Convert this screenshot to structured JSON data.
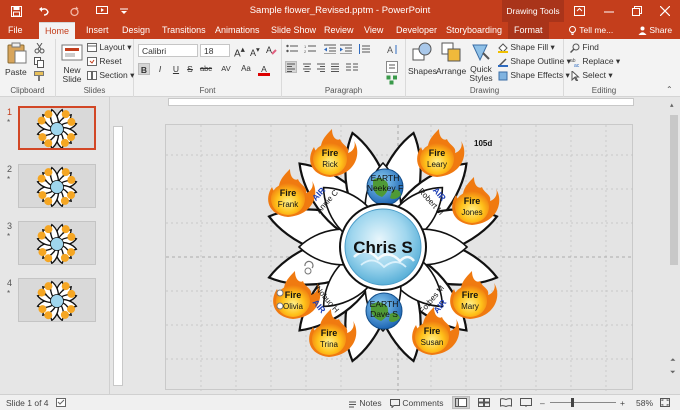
{
  "titlebar": {
    "document_title": "Sample flower_Revised.pptm - PowerPoint",
    "context_tools": "Drawing Tools",
    "icons": [
      "save-icon",
      "undo-icon",
      "redo-icon",
      "start-from-beginning-icon",
      "customize-qat-icon"
    ]
  },
  "tabs": [
    "File",
    "Home",
    "Insert",
    "Design",
    "Transitions",
    "Animations",
    "Slide Show",
    "Review",
    "View",
    "Developer",
    "Storyboarding",
    "Format"
  ],
  "active_tab": "Home",
  "tell_me": "Tell me...",
  "share": "Share",
  "ribbon": {
    "clipboard": {
      "paste": "Paste",
      "label": "Clipboard"
    },
    "slides": {
      "new_slide": "New Slide",
      "layout": "Layout",
      "reset": "Reset",
      "section": "Section",
      "label": "Slides"
    },
    "font": {
      "font_name": "Calibri",
      "font_size": "18",
      "label": "Font",
      "buttons": [
        "B",
        "I",
        "U",
        "S",
        "abc",
        "AV",
        "Aa",
        "A"
      ]
    },
    "paragraph": {
      "label": "Paragraph"
    },
    "drawing": {
      "shapes": "Shapes",
      "arrange": "Arrange",
      "quick_styles": "Quick Styles",
      "shape_fill": "Shape Fill",
      "shape_outline": "Shape Outline",
      "shape_effects": "Shape Effects",
      "label": "Drawing"
    },
    "editing": {
      "find": "Find",
      "replace": "Replace",
      "select": "Select",
      "label": "Editing"
    }
  },
  "thumbnails": [
    {
      "number": "1",
      "marker": "*",
      "selected": true
    },
    {
      "number": "2",
      "marker": "*",
      "selected": false
    },
    {
      "number": "3",
      "marker": "*",
      "selected": false
    },
    {
      "number": "4",
      "marker": "*",
      "selected": false
    }
  ],
  "slide": {
    "corner_label": "105d",
    "center_name": "Chris S",
    "earth": [
      {
        "label": "EARTH",
        "name": "Neekey F"
      },
      {
        "label": "EARTH",
        "name": "Dave S"
      }
    ],
    "air": [
      {
        "label": "AIR",
        "name": "Annie C"
      },
      {
        "label": "AIR",
        "name": "Robert M"
      },
      {
        "label": "AIR",
        "name": "Nobuo H"
      },
      {
        "label": "AIR",
        "name": "Forbes M"
      }
    ],
    "fire": [
      {
        "label": "Fire",
        "name": "Rick"
      },
      {
        "label": "Fire",
        "name": "Leary"
      },
      {
        "label": "Fire",
        "name": "Frank"
      },
      {
        "label": "Fire",
        "name": "Jones"
      },
      {
        "label": "Fire",
        "name": "Olivia"
      },
      {
        "label": "Fire",
        "name": "Mary"
      },
      {
        "label": "Fire",
        "name": "Trina"
      },
      {
        "label": "Fire",
        "name": "Susan"
      }
    ]
  },
  "statusbar": {
    "slide_info": "Slide 1 of 4",
    "notes": "Notes",
    "comments": "Comments",
    "zoom": "58%"
  },
  "colors": {
    "accent": "#c43e1c",
    "fire": "#f7a21b",
    "water": "#8fcdea",
    "air_text": "#1f3fb5"
  }
}
